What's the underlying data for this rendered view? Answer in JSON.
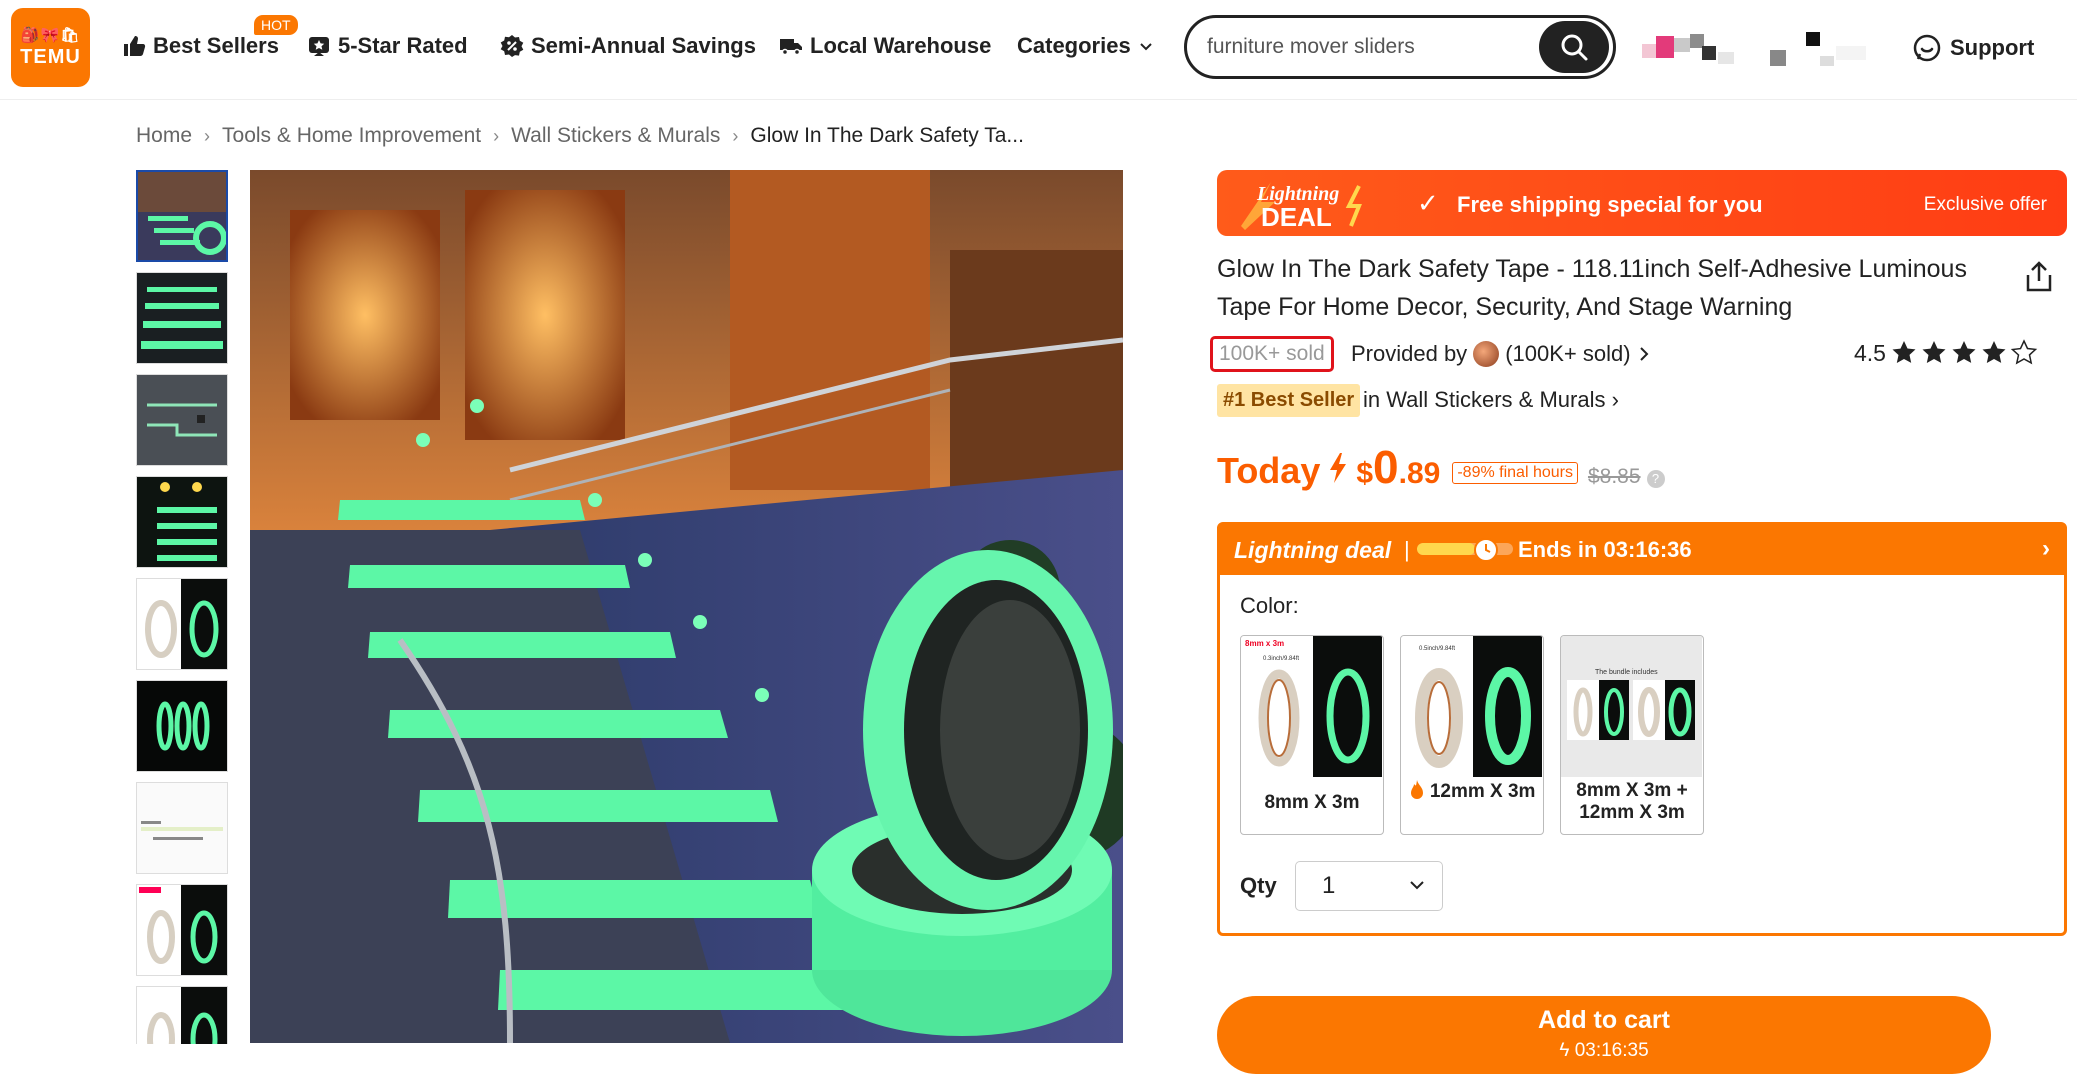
{
  "header": {
    "logo_top": "🎒🎀🛍",
    "logo_text": "TEMU",
    "nav": [
      {
        "label": "Best Sellers",
        "icon": "thumbs-up-icon"
      },
      {
        "label": "5-Star Rated",
        "icon": "star-badge-icon"
      },
      {
        "label": "Semi-Annual Savings",
        "icon": "percent-badge-icon"
      },
      {
        "label": "Local Warehouse",
        "icon": "truck-icon"
      },
      {
        "label": "Categories",
        "icon": "chevron-down-icon"
      }
    ],
    "hot_badge": "HOT",
    "search": {
      "value": "furniture mover sliders",
      "placeholder": "furniture mover sliders"
    },
    "support_label": "Support"
  },
  "breadcrumb": {
    "items": [
      "Home",
      "Tools & Home Improvement",
      "Wall Stickers & Murals",
      "Glow In The Dark Safety Ta..."
    ]
  },
  "banner": {
    "logo_top": "Lightning",
    "logo_bottom": "DEAL",
    "text": "Free shipping special for you",
    "exclusive": "Exclusive offer"
  },
  "product": {
    "title": "Glow In The Dark Safety Tape - 118.11inch Self-Adhesive Luminous Tape For Home Decor, Security, And Stage Warning",
    "sold": "100K+ sold",
    "provided_by": "Provided by",
    "seller_sold": "(100K+ sold)",
    "rating": "4.5",
    "rating_value": 4.5,
    "best_seller_badge": "#1 Best Seller",
    "best_seller_category": "in Wall Stickers & Murals",
    "price": {
      "today_label": "Today",
      "currency": "$",
      "main": "0",
      "cents": ".89",
      "discount": "-89% final hours",
      "original": "$8.85"
    }
  },
  "lightning_deal": {
    "label": "Lightning deal",
    "separator": "|",
    "progress": 0.6,
    "ends_text": "Ends in 03:16:36",
    "color_label": "Color:",
    "options": [
      {
        "label": "8mm X 3m",
        "tag": "8mm x 3m",
        "sub": "0.3inch/9.84ft",
        "selected": false
      },
      {
        "label": "12mm X 3m",
        "tag": "",
        "sub": "0.5inch/9.84ft",
        "selected": false,
        "hot": true
      },
      {
        "label": "8mm X 3m + 12mm X 3m",
        "tag": "",
        "sub": "The bundle includes",
        "selected": true
      }
    ],
    "qty_label": "Qty",
    "qty_value": "1"
  },
  "cart": {
    "label": "Add to cart",
    "timer": "03:16:35"
  },
  "colors": {
    "brand": "#fb7701",
    "price": "#fb5d00",
    "glow": "#5cf7a6",
    "banner": "#ff4a18"
  }
}
